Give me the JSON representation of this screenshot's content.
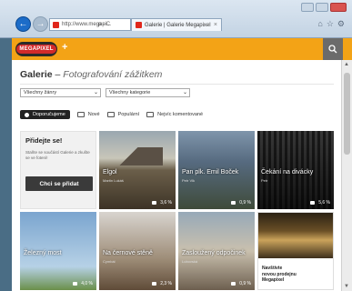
{
  "browser": {
    "address": "http://www.megapi...",
    "address_controls": "ρ - C",
    "tab_title": "Galerie | Galerie Megapixel",
    "tab_close": "×"
  },
  "site": {
    "logo_text": "MEGAPIXEL",
    "plus": "+"
  },
  "page": {
    "title_main": "Galerie",
    "title_sep": " – ",
    "title_sub": "Fotografování zážitkem",
    "select_themes": "Všechny žánry",
    "select_categories": "Všechny kategorie",
    "filters": [
      {
        "label": "Doporučujeme",
        "active": true
      },
      {
        "label": "Nové",
        "active": false
      },
      {
        "label": "Populární",
        "active": false
      },
      {
        "label": "Nejvíc komentované",
        "active": false
      }
    ]
  },
  "promo": {
    "heading": "Přidejte se!",
    "text": "Staňte se součástí Galerie a zkušte se ve fotení!",
    "button": "Chci se přidat"
  },
  "cards": [
    {
      "caption": "Elgol",
      "sub": "Martin Lukáš",
      "stat": "3,6 %"
    },
    {
      "caption": "Pan plk. Emil Boček",
      "sub": "Petr Vlk",
      "stat": "0,9 %"
    },
    {
      "caption": "Čekání na divácky",
      "sub": "Petr",
      "stat": "5,6 %"
    },
    {
      "caption": "Železný most",
      "sub": "",
      "stat": "4,0 %"
    },
    {
      "caption": "Na černové stěně",
      "sub": "Cymbál",
      "stat": "2,3 %"
    },
    {
      "caption": "Zasloužený odpočinek",
      "sub": "Lubovská",
      "stat": "0,9 %"
    }
  ],
  "promo2": {
    "text_line1": "Navštivte",
    "text_line2": "novou prodejnu",
    "text_line3": "Megapixel"
  }
}
